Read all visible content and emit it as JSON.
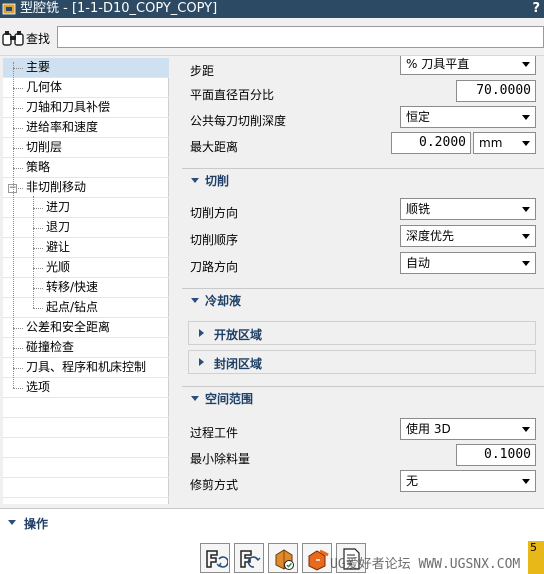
{
  "window": {
    "title": "型腔铣 - [1-1-D10_COPY_COPY]",
    "help_label": "?"
  },
  "search": {
    "label": "查找",
    "value": ""
  },
  "tree": {
    "items": [
      {
        "label": "主要",
        "level": 0,
        "selected": true
      },
      {
        "label": "几何体",
        "level": 0
      },
      {
        "label": "刀轴和刀具补偿",
        "level": 0
      },
      {
        "label": "进给率和速度",
        "level": 0
      },
      {
        "label": "切削层",
        "level": 0
      },
      {
        "label": "策略",
        "level": 0
      },
      {
        "label": "非切削移动",
        "level": 0,
        "expanded": true
      },
      {
        "label": "进刀",
        "level": 1
      },
      {
        "label": "退刀",
        "level": 1
      },
      {
        "label": "避让",
        "level": 1
      },
      {
        "label": "光顺",
        "level": 1
      },
      {
        "label": "转移/快速",
        "level": 1
      },
      {
        "label": "起点/钻点",
        "level": 1
      },
      {
        "label": "公差和安全距离",
        "level": 0
      },
      {
        "label": "碰撞检查",
        "level": 0
      },
      {
        "label": "刀具、程序和机床控制",
        "level": 0
      },
      {
        "label": "选项",
        "level": 0
      }
    ],
    "collapse_glyph": "−"
  },
  "main": {
    "stepover_label": "步距",
    "stepover_value": "% 刀具平直",
    "percent_flat_label": "平面直径百分比",
    "percent_flat_value": "70.0000",
    "common_depth_label": "公共每刀切削深度",
    "common_depth_value": "恒定",
    "max_distance_label": "最大距离",
    "max_distance_value": "0.2000",
    "max_distance_unit": "mm"
  },
  "cutting": {
    "title": "切削",
    "direction_label": "切削方向",
    "direction_value": "顺铣",
    "order_label": "切削顺序",
    "order_value": "深度优先",
    "path_dir_label": "刀路方向",
    "path_dir_value": "自动"
  },
  "coolant": {
    "title": "冷却液",
    "open_region": "开放区域",
    "closed_region": "封闭区域"
  },
  "spatial": {
    "title": "空间范围",
    "ipw_label": "过程工件",
    "ipw_value": "使用 3D",
    "min_removal_label": "最小除料量",
    "min_removal_value": "0.1000",
    "trim_label": "修剪方式",
    "trim_value": "无"
  },
  "actions": {
    "title": "操作",
    "watermark": "UG爱好者论坛 WWW.UGSNX.COM",
    "corner_badge": "5"
  },
  "colors": {
    "titlebar": "#2d4a64",
    "group_title": "#1f3f66",
    "tree_selected": "#cfe1f0"
  }
}
